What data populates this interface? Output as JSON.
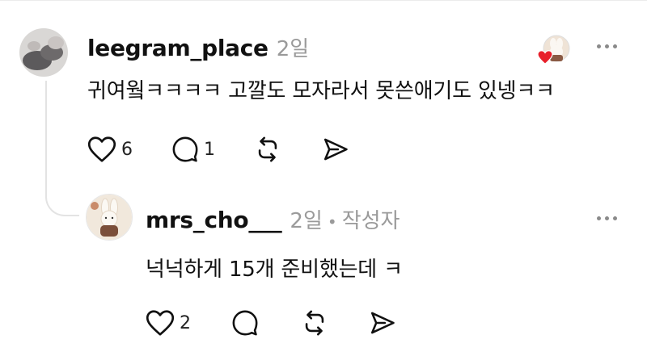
{
  "comments": [
    {
      "username": "leegram_place",
      "time": "2일",
      "text": "귀여웤ㅋㅋㅋㅋ 고깔도 모자라서 못쓴애기도 있넹ㅋㅋ",
      "likes": "6",
      "replies": "1",
      "avatar_icon": "profile-photo",
      "liked_by_author": true
    },
    {
      "username": "mrs_cho___",
      "time": "2일",
      "separator": "•",
      "author_label": "작성자",
      "text": "넉넉하게 15개 준비했는데 ㅋ",
      "likes": "2",
      "avatar_icon": "rabbit-profile-photo"
    }
  ],
  "icons": {
    "like": "heart-icon",
    "reply": "comment-bubble-icon",
    "repost": "repost-icon",
    "share": "send-icon",
    "more": "more-options-icon"
  },
  "colors": {
    "heart_badge": "#e8202b",
    "muted_text": "#9a9a9a"
  }
}
